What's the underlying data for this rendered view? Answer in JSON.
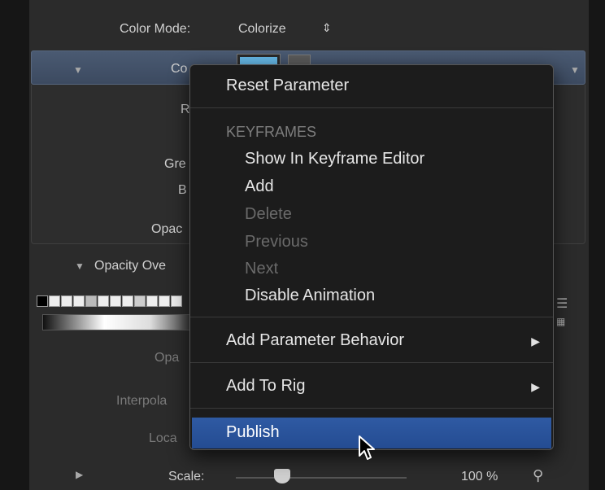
{
  "panel": {
    "color_mode_label": "Color Mode:",
    "color_mode_value": "Colorize",
    "color_label_visible": "Co",
    "r_label_visible": "R",
    "green_label_visible": "Gre",
    "blue_label_visible": "B",
    "opacity_label_visible": "Opac",
    "opacity_over_label_visible": "Opacity Ove",
    "opa_label_visible": "Opa",
    "interpola_label_visible": "Interpola",
    "loca_label_visible": "Loca",
    "scale_label": "Scale:",
    "scale_value": "100 %"
  },
  "menu": {
    "reset": "Reset Parameter",
    "keyframes_header": "KEYFRAMES",
    "show_in_editor": "Show In Keyframe Editor",
    "add": "Add",
    "delete": "Delete",
    "previous": "Previous",
    "next": "Next",
    "disable_animation": "Disable Animation",
    "add_parameter_behavior": "Add Parameter Behavior",
    "add_to_rig": "Add To Rig",
    "publish": "Publish"
  },
  "colors": {
    "menu_highlight": "#2a5299",
    "swatch": "#66b8e6"
  }
}
